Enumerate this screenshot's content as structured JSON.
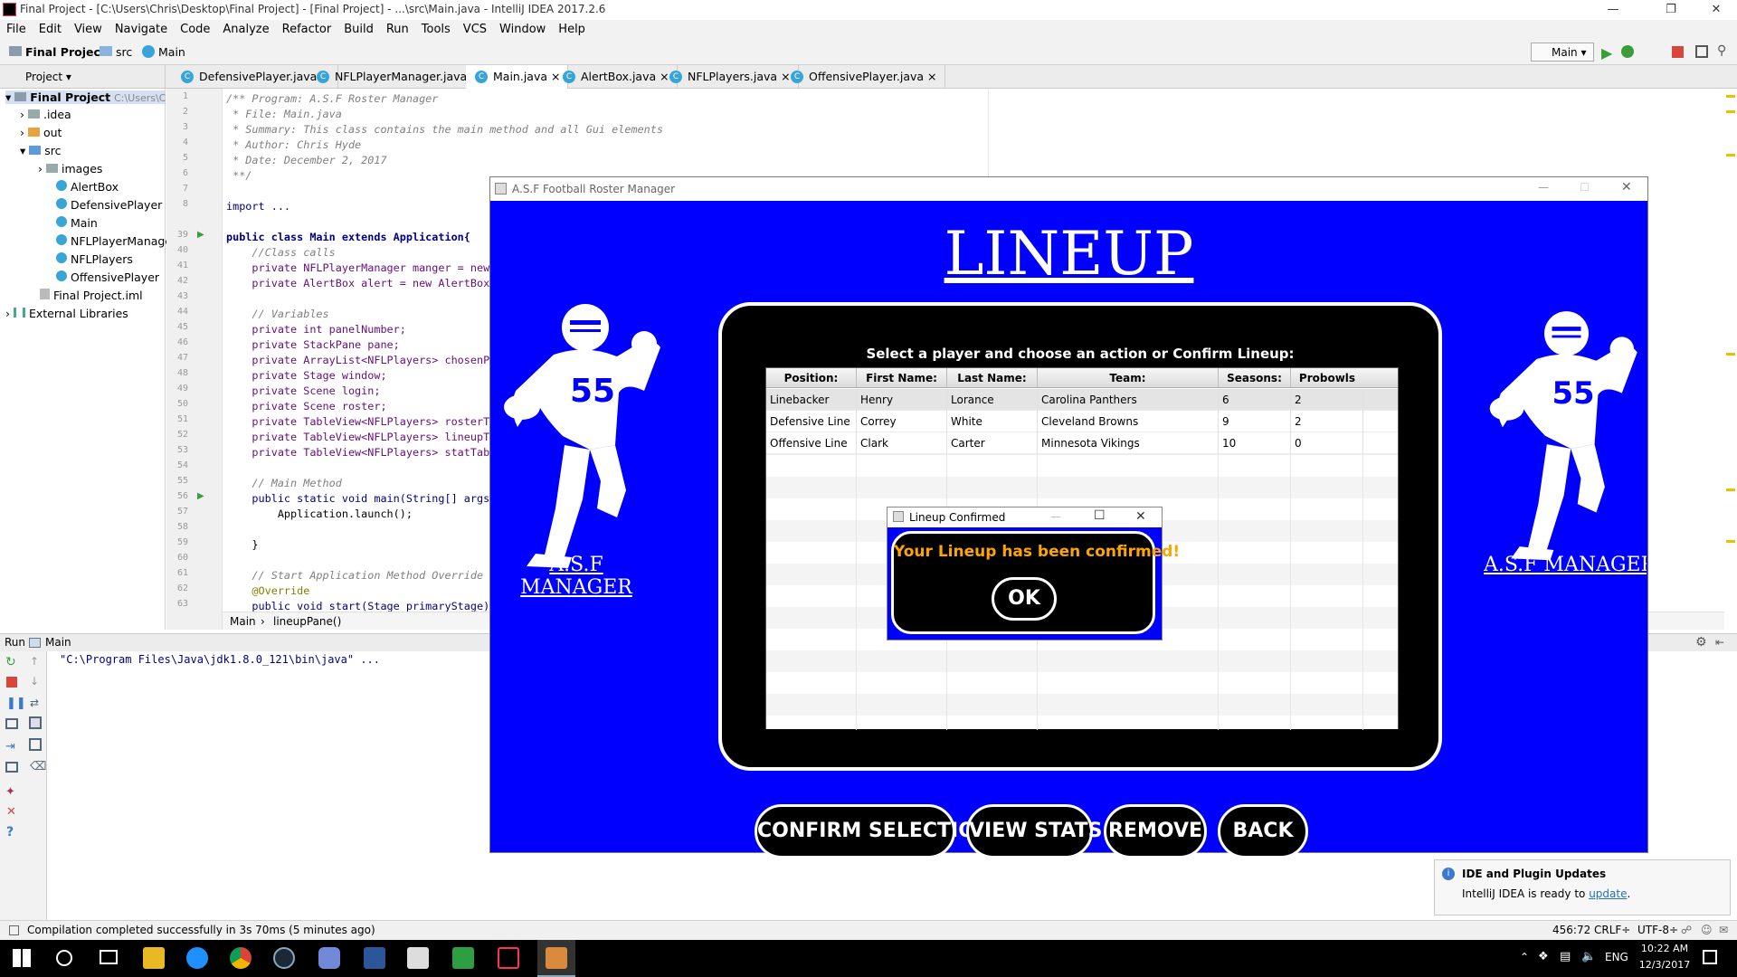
{
  "window": {
    "title": "Final Project - [C:\\Users\\Chris\\Desktop\\Final Project] - [Final Project] - ...\\src\\Main.java - IntelliJ IDEA 2017.2.6"
  },
  "menu": [
    "File",
    "Edit",
    "View",
    "Navigate",
    "Code",
    "Analyze",
    "Refactor",
    "Build",
    "Run",
    "Tools",
    "VCS",
    "Window",
    "Help"
  ],
  "nav": {
    "project": "Final Project",
    "src": "src",
    "file": "Main",
    "run_config": "Main"
  },
  "panel_label": "Project",
  "editor_tabs": [
    "DefensivePlayer.java",
    "NFLPlayerManager.java",
    "Main.java",
    "AlertBox.java",
    "NFLPlayers.java",
    "OffensivePlayer.java"
  ],
  "tree": [
    {
      "label": "Final Project",
      "extra": "C:\\Users\\Chr"
    },
    {
      "label": ".idea"
    },
    {
      "label": "out"
    },
    {
      "label": "src"
    },
    {
      "label": "images"
    },
    {
      "label": "AlertBox"
    },
    {
      "label": "DefensivePlayer"
    },
    {
      "label": "Main"
    },
    {
      "label": "NFLPlayerManager"
    },
    {
      "label": "NFLPlayers"
    },
    {
      "label": "OffensivePlayer"
    },
    {
      "label": "Final Project.iml"
    },
    {
      "label": "External Libraries"
    }
  ],
  "line_numbers": [
    "1",
    "2",
    "3",
    "4",
    "5",
    "6",
    "7",
    "8",
    "39",
    "40",
    "41",
    "42",
    "43",
    "44",
    "45",
    "46",
    "47",
    "48",
    "49",
    "50",
    "51",
    "52",
    "53",
    "54",
    "55",
    "56",
    "57",
    "58",
    "59",
    "60",
    "61",
    "62",
    "63"
  ],
  "code_lines": [
    "/** Program: A.S.F Roster Manager",
    " * File: Main.java",
    " * Summary: This class contains the main method and all Gui elements",
    " * Author: Chris Hyde",
    " * Date: December 2, 2017",
    " **/",
    "",
    "import ...",
    "",
    "public class Main extends Application{",
    "    //Class calls",
    "    private NFLPlayerManager manger = new",
    "    private AlertBox alert = new AlertBox",
    "",
    "    // Variables",
    "    private int panelNumber;",
    "    private StackPane pane;",
    "    private ArrayList<NFLPlayers> chosenPl",
    "    private Stage window;",
    "    private Scene login;",
    "    private Scene roster;",
    "    private TableView<NFLPlayers> rosterTa",
    "    private TableView<NFLPlayers> lineupTa",
    "    private TableView<NFLPlayers> statTabl",
    "",
    "    // Main Method",
    "    public static void main(String[] args)",
    "        Application.launch();",
    "",
    "    }",
    "",
    "    // Start Application Method Override",
    "    @Override",
    "    public void start(Stage primaryStage)"
  ],
  "breadcrumb": {
    "cls": "Main",
    "method": "lineupPane()"
  },
  "run": {
    "label": "Run",
    "tab": "Main",
    "output": "\"C:\\Program Files\\Java\\jdk1.8.0_121\\bin\\java\" ..."
  },
  "status": {
    "message": "Compilation completed successfully in 3s 70ms (5 minutes ago)",
    "position": "456:72",
    "crlf": "CRLF÷",
    "encoding": "UTF-8÷"
  },
  "notification": {
    "title": "IDE and Plugin Updates",
    "text": "IntelliJ IDEA is ready to ",
    "link": "update",
    "tail": "."
  },
  "app": {
    "title": "A.S.F Football Roster Manager",
    "heading": "LINEUP",
    "logo_text": "A.S.F MANAGER",
    "prompt": "Select a player and choose an action or Confirm Lineup:",
    "columns": [
      "Position:",
      "First Name:",
      "Last Name:",
      "Team:",
      "Seasons:",
      "Probowls"
    ],
    "rows": [
      [
        "Linebacker",
        "Henry",
        "Lorance",
        "Carolina Panthers",
        "6",
        "2"
      ],
      [
        "Defensive Line",
        "Correy",
        "White",
        "Cleveland Browns",
        "9",
        "2"
      ],
      [
        "Offensive Line",
        "Clark",
        "Carter",
        "Minnesota Vikings",
        "10",
        "0"
      ]
    ],
    "buttons": {
      "confirm": "CONFIRM SELECTION",
      "stats": "VIEW STATS",
      "remove": "REMOVE",
      "back": "BACK"
    }
  },
  "alert": {
    "title": "Lineup Confirmed",
    "message": "Your Lineup has been confirmed!",
    "ok": "OK"
  },
  "taskbar": {
    "lang": "ENG",
    "time": "10:22 AM",
    "date": "12/3/2017"
  },
  "colors": {
    "app_blue": "#0000ff",
    "alert_orange": "#ffa500",
    "ide_bg": "#f2f2f2"
  }
}
